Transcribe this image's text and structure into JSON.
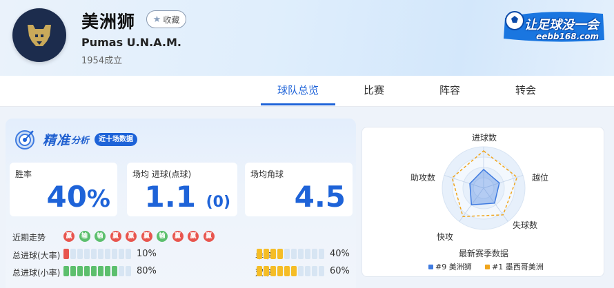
{
  "team": {
    "name": "美洲狮",
    "name_en": "Pumas U.N.A.M.",
    "founded": "1954成立",
    "favorite_label": "收藏"
  },
  "brand": {
    "word": "让足球没一会",
    "url": "eebb168.com"
  },
  "tabs": [
    {
      "label": "球队总览",
      "active": true
    },
    {
      "label": "比赛",
      "active": false
    },
    {
      "label": "阵容",
      "active": false
    },
    {
      "label": "转会",
      "active": false
    }
  ],
  "analysis": {
    "title_main": "精准",
    "title_sub": "分析",
    "badge": "近十场数据",
    "win_rate": {
      "label": "胜率",
      "value": "40",
      "unit": "%"
    },
    "avg_goals": {
      "label": "场均 进球(点球)",
      "value": "1.1",
      "penalty": "(0)"
    },
    "avg_corners": {
      "label": "场均角球",
      "value": "4.5"
    },
    "recent_form": {
      "label": "近期走势",
      "results": [
        "赢",
        "输",
        "输",
        "赢",
        "赢",
        "赢",
        "输",
        "赢",
        "赢",
        "赢"
      ]
    },
    "goals_big": {
      "label": "总进球(大率)",
      "percent": "10%",
      "fraction": 0.1,
      "color": "#e8554e"
    },
    "goals_small": {
      "label": "总进球(小率)",
      "percent": "80%",
      "fraction": 0.8,
      "color": "#5cbf6d"
    },
    "odd_rate": {
      "label": "单率",
      "percent": "40%",
      "fraction": 0.4,
      "color": "#f5bd26"
    },
    "even_rate": {
      "label": "双率",
      "percent": "60%",
      "fraction": 0.6,
      "color": "#f5bd26"
    }
  },
  "radar": {
    "axes": [
      "进球数",
      "越位",
      "失球数",
      "快攻",
      "助攻数"
    ],
    "caption": "最新赛季数据",
    "legend": [
      {
        "label": "#9 美洲狮",
        "color": "#3f7be0"
      },
      {
        "label": "#1 墨西哥美洲",
        "color": "#f0a51c"
      }
    ],
    "series": [
      {
        "name": "#9 美洲狮",
        "values": [
          0.45,
          0.4,
          0.45,
          0.5,
          0.35
        ]
      },
      {
        "name": "#1 墨西哥美洲",
        "values": [
          0.9,
          0.85,
          0.8,
          0.85,
          0.8
        ]
      }
    ]
  }
}
